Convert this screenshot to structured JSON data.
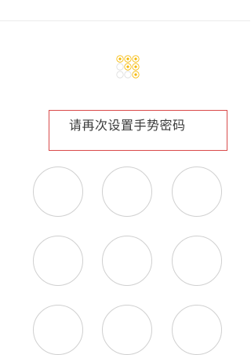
{
  "title": {
    "prompt": "请再次设置手势密码"
  },
  "preview_pattern": {
    "rows": 3,
    "cols": 3,
    "selected": [
      1,
      2,
      3,
      5,
      6,
      9
    ],
    "active_color": "#f5b800",
    "inactive_color": "#dcdcdc"
  },
  "gesture_grid": {
    "nodes": [
      1,
      2,
      3,
      4,
      5,
      6,
      7,
      8,
      9
    ],
    "node_border_color": "#d0d0d0"
  },
  "highlight": {
    "border_color": "#d94a4a"
  }
}
